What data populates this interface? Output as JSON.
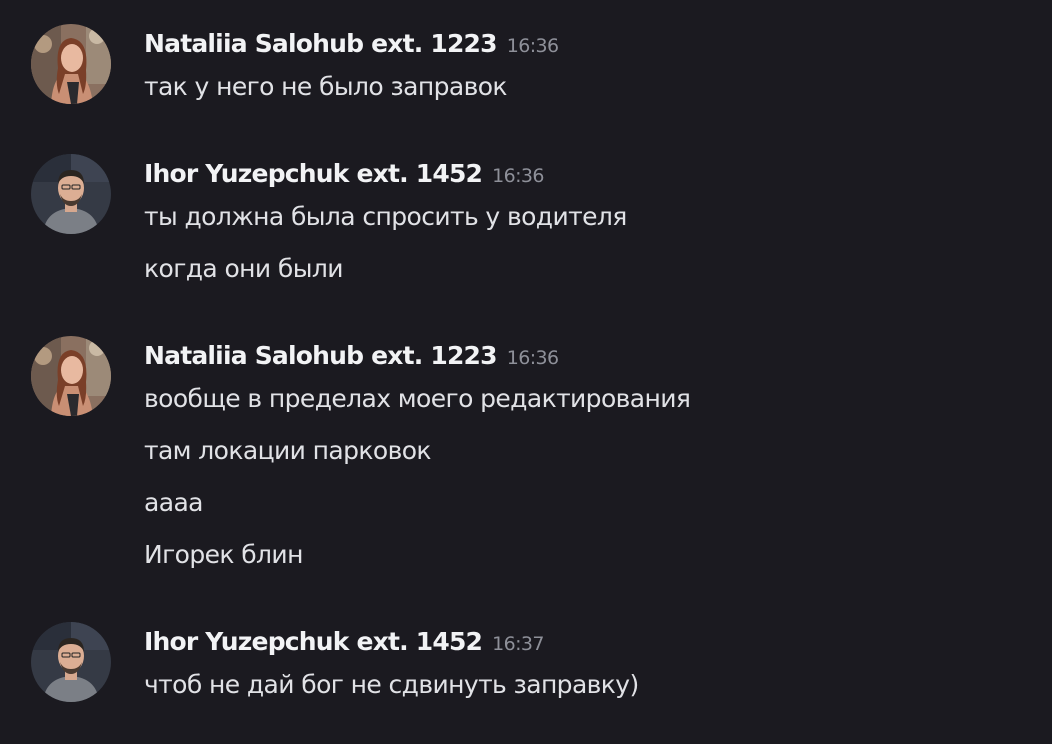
{
  "chat": {
    "messages": [
      {
        "author": "Nataliia Salohub ext. 1223",
        "time": "16:36",
        "avatar_icon": "woman-portrait-avatar",
        "lines": [
          "так у него не было заправок"
        ]
      },
      {
        "author": "Ihor Yuzepchuk ext. 1452",
        "time": "16:36",
        "avatar_icon": "man-portrait-avatar",
        "lines": [
          "ты должна была спросить у водителя",
          "когда они были"
        ]
      },
      {
        "author": "Nataliia Salohub ext. 1223",
        "time": "16:36",
        "avatar_icon": "woman-portrait-avatar",
        "lines": [
          "вообще в пределах моего редактирования",
          "там локации парковок",
          "аааа",
          "Игорек блин"
        ]
      },
      {
        "author": "Ihor Yuzepchuk ext. 1452",
        "time": "16:37",
        "avatar_icon": "man-portrait-avatar",
        "lines": [
          "чтоб не дай бог не сдвинуть заправку)"
        ]
      }
    ]
  },
  "colors": {
    "background": "#1b1a20",
    "author": "#f2f3f5",
    "timestamp": "#8e9099",
    "message_text": "#e1e2e6"
  }
}
